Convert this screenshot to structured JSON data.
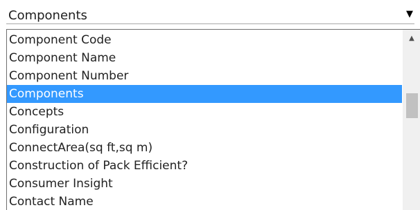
{
  "select": {
    "value": "Components",
    "arrow_icon": "triangle-down-icon"
  },
  "dropdown": {
    "options": [
      "Component Code",
      "Component Name",
      "Component Number",
      "Components",
      "Concepts",
      "Configuration",
      "ConnectArea(sq ft,sq m)",
      "Construction of Pack Efficient?",
      "Consumer Insight",
      "Contact Name"
    ],
    "selected": "Components",
    "scroll_position": 0.3
  },
  "colors": {
    "selection": "#3399ff",
    "selection_text": "#ffffff",
    "text": "#222222",
    "scrollbar_track": "#f0f0f0",
    "scrollbar_thumb": "#c1c1c1"
  },
  "icons": {
    "scroll_up": "triangle-up-icon"
  }
}
